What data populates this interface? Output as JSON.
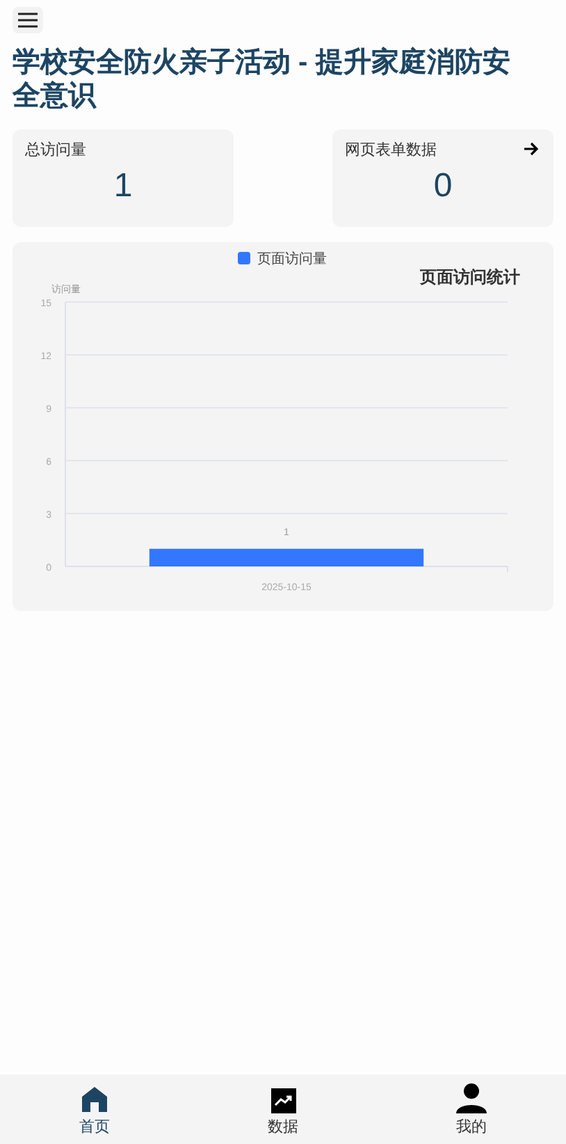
{
  "title": "学校安全防火亲子活动 - 提升家庭消防安全意识",
  "stats": [
    {
      "label": "总访问量",
      "value": "1",
      "arrow": false
    },
    {
      "label": "网页表单数据",
      "value": "0",
      "arrow": true
    }
  ],
  "chart": {
    "title": "页面访问统计",
    "chart_data": {
      "type": "bar",
      "ylabel": "访问量",
      "categories": [
        "2025-10-15"
      ],
      "series": [
        {
          "name": "页面访问量",
          "color": "#3377ff",
          "values": [
            1
          ]
        }
      ],
      "ylim": [
        0,
        15
      ],
      "yticks": [
        0,
        3,
        6,
        9,
        12,
        15
      ],
      "data_labels": true,
      "grid": true
    }
  },
  "nav": [
    {
      "label": "首页",
      "kind": "home",
      "selected": true
    },
    {
      "label": "数据",
      "kind": "chart",
      "selected": false
    },
    {
      "label": "我的",
      "kind": "user",
      "selected": false
    }
  ]
}
